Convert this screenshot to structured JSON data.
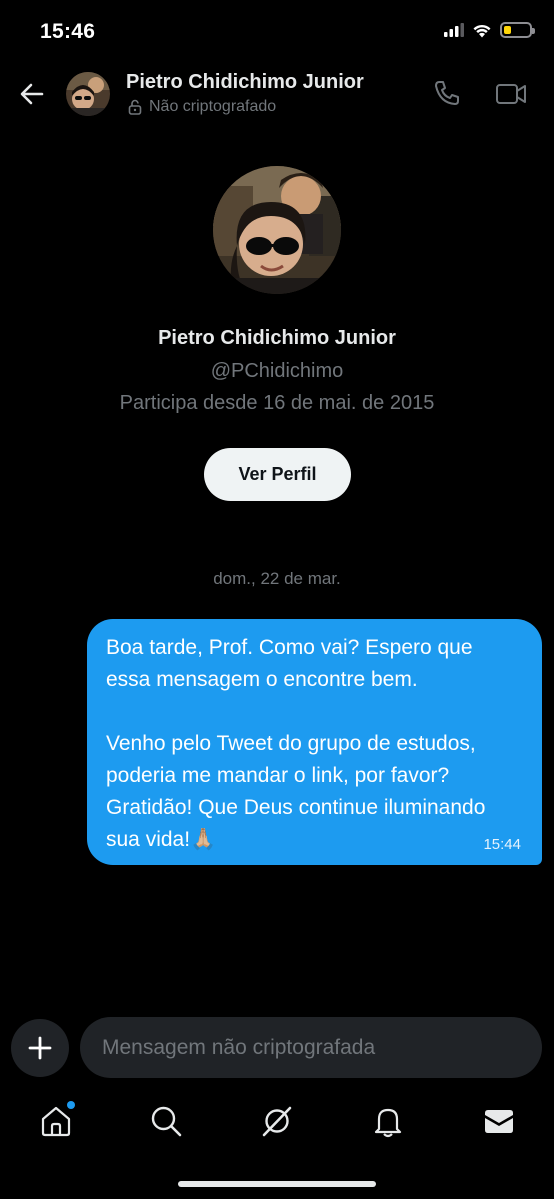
{
  "status_bar": {
    "time": "15:46",
    "battery_level": 0.3,
    "battery_color": "#ffd60a"
  },
  "header": {
    "name": "Pietro Chidichimo Junior",
    "encryption_status": "Não criptografado"
  },
  "profile": {
    "name": "Pietro Chidichimo Junior",
    "handle": "@PChidichimo",
    "joined": "Participa desde 16 de mai. de 2015",
    "view_profile_label": "Ver Perfil"
  },
  "conversation": {
    "date_separator": "dom., 22 de mar.",
    "messages": [
      {
        "direction": "outgoing",
        "text": "Boa tarde, Prof. Como vai? Espero que\nessa mensagem o encontre bem.\n\nVenho pelo Tweet do grupo de estudos,\npoderia me mandar o link, por favor?\nGratidão! Que Deus continue iluminando\nsua vida!🙏🏼",
        "time": "15:44"
      }
    ]
  },
  "composer": {
    "placeholder": "Mensagem não criptografada"
  },
  "nav": {
    "items": [
      {
        "icon": "home-icon",
        "has_notification_dot": true
      },
      {
        "icon": "search-icon"
      },
      {
        "icon": "grok-icon"
      },
      {
        "icon": "bell-icon"
      },
      {
        "icon": "mail-icon",
        "active": true
      }
    ]
  },
  "colors": {
    "accent": "#1d9bf0",
    "background": "#000000",
    "secondary_text": "#71767b"
  }
}
